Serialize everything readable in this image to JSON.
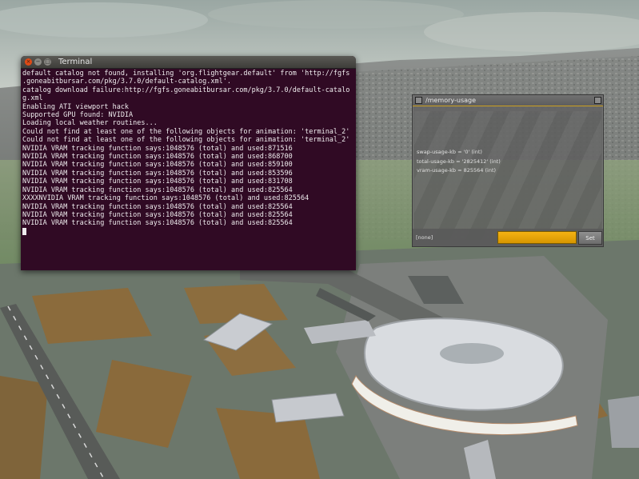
{
  "terminal": {
    "title": "Terminal",
    "lines": [
      "default catalog not found, installing 'org.flightgear.default' from 'http://fgfs",
      ".goneabitbursar.com/pkg/3.7.0/default-catalog.xml'.",
      "catalog download failure:http://fgfs.goneabitbursar.com/pkg/3.7.0/default-catalo",
      "g.xml",
      "Enabling ATI viewport hack",
      "Supported GPU found: NVIDIA",
      "Loading local weather routines...",
      "Could not find at least one of the following objects for animation: 'terminal_2'",
      "Could not find at least one of the following objects for animation: 'terminal_2'",
      "NVIDIA VRAM tracking function says:1048576 (total) and used:871516",
      "NVIDIA VRAM tracking function says:1048576 (total) and used:868700",
      "NVIDIA VRAM tracking function says:1048576 (total) and used:859100",
      "NVIDIA VRAM tracking function says:1048576 (total) and used:853596",
      "NVIDIA VRAM tracking function says:1048576 (total) and used:831708",
      "NVIDIA VRAM tracking function says:1048576 (total) and used:825564",
      "XXXXNVIDIA VRAM tracking function says:1048576 (total) and used:825564",
      "NVIDIA VRAM tracking function says:1048576 (total) and used:825564",
      "NVIDIA VRAM tracking function says:1048576 (total) and used:825564",
      "NVIDIA VRAM tracking function says:1048576 (total) and used:825564"
    ]
  },
  "dialog": {
    "title": "/memory-usage",
    "properties": [
      "swap-usage-kb = '0' (int)",
      "total-usage-kb = '2825412' (int)",
      "vram-usage-kb = 825564 (int)"
    ],
    "selected_label": "[none]",
    "set_label": "Set"
  },
  "colors": {
    "terminal_bg": "#300a24",
    "accent": "#f4b213"
  }
}
